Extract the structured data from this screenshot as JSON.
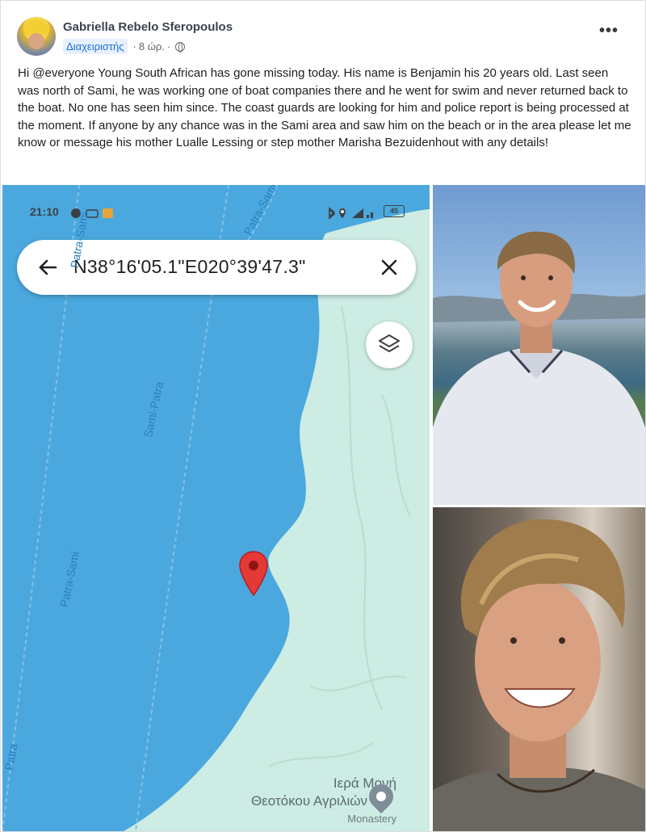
{
  "post": {
    "author": "Gabriella Rebelo Sferopoulos",
    "role": "Διαχειριστής",
    "time": "8 ώρ.",
    "separator": "·",
    "more_label": "•••",
    "text": "Hi @everyone  Young South African has gone missing today. His name is Benjamin his 20 years old. Last seen was north of Sami, he was working one of boat companies there and he went for swim and never returned back to the boat. No one has seen him since. The coast guards are looking for him and police report is being processed at the moment. If anyone by any chance was in the Sami area and saw him on the beach or in the area please let me know or message his mother Lualle Lessing or step mother Marisha Bezuidenhout  with any details!"
  },
  "map_screenshot": {
    "status_time": "21:10",
    "battery": "45",
    "search_query": "N38°16'05.1\"E020°39'47.3\"",
    "route_labels": [
      "Patra-Sami",
      "Sami-Patra",
      "Patra-Sami",
      "Patra-Sami",
      "Patra"
    ],
    "poi_name_line1": "Ιερά Μονή",
    "poi_name_line2": "Θεοτόκου Αγριλιών",
    "poi_subtitle": "Monastery",
    "icons": [
      "back-arrow-icon",
      "close-icon",
      "layers-icon",
      "map-pin-icon",
      "poi-icon"
    ]
  },
  "colors": {
    "water": "#4aa8de",
    "land": "#cdece3",
    "pin": "#e53935",
    "badge_text": "#1a6ed8",
    "badge_bg": "#e7f0fd"
  }
}
